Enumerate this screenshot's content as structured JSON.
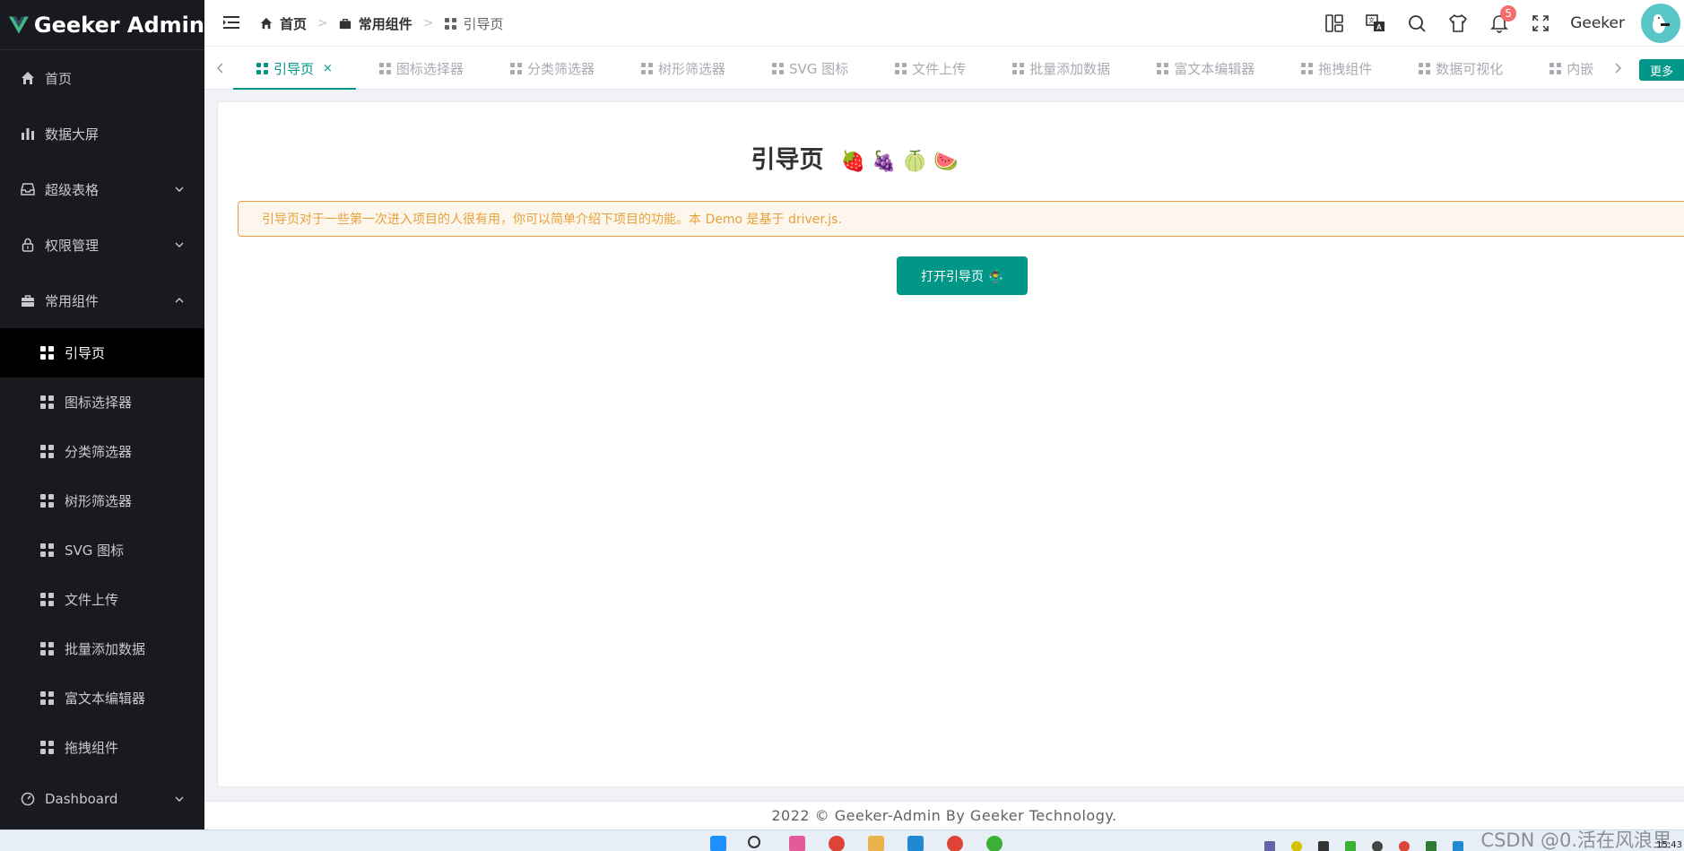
{
  "app": {
    "logo_text": "Geeker Admin"
  },
  "sidebar": {
    "items": [
      {
        "label": "首页",
        "icon": "home-icon"
      },
      {
        "label": "数据大屏",
        "icon": "bar-chart-icon"
      },
      {
        "label": "超级表格",
        "icon": "inbox-icon",
        "expandable": true
      },
      {
        "label": "权限管理",
        "icon": "lock-icon",
        "expandable": true
      },
      {
        "label": "常用组件",
        "icon": "briefcase-icon",
        "expanded": true
      }
    ],
    "sub_items": [
      {
        "label": "引导页",
        "active": true
      },
      {
        "label": "图标选择器"
      },
      {
        "label": "分类筛选器"
      },
      {
        "label": "树形筛选器"
      },
      {
        "label": "SVG 图标"
      },
      {
        "label": "文件上传"
      },
      {
        "label": "批量添加数据"
      },
      {
        "label": "富文本编辑器"
      },
      {
        "label": "拖拽组件"
      }
    ],
    "dashboard": {
      "label": "Dashboard",
      "icon": "odometer-icon"
    }
  },
  "header": {
    "breadcrumb": [
      {
        "label": "首页",
        "icon": "home-icon"
      },
      {
        "label": "常用组件",
        "icon": "briefcase-icon"
      },
      {
        "label": "引导页",
        "icon": "grid-icon"
      }
    ],
    "notification_count": "5",
    "username": "Geeker"
  },
  "tabs": {
    "items": [
      {
        "label": "引导页",
        "active": true,
        "closable": true
      },
      {
        "label": "图标选择器"
      },
      {
        "label": "分类筛选器"
      },
      {
        "label": "树形筛选器"
      },
      {
        "label": "SVG 图标"
      },
      {
        "label": "文件上传"
      },
      {
        "label": "批量添加数据"
      },
      {
        "label": "富文本编辑器"
      },
      {
        "label": "拖拽组件"
      },
      {
        "label": "数据可视化"
      },
      {
        "label": "内嵌"
      }
    ],
    "close_glyph": "×",
    "more_label": "更多"
  },
  "main": {
    "title": "引导页",
    "title_emoji": "🍓 🍇 🍈 🍉",
    "alert_text": "引导页对于一些第一次进入项目的人很有用，你可以简单介绍下项目的功能。本 Demo 是基于 driver.js.",
    "open_button_label": "打开引导页 🤹‍♂️"
  },
  "footer": {
    "text": "2022 © Geeker-Admin By Geeker Technology."
  },
  "taskbar": {
    "watermark": "CSDN @0.活在风浪里",
    "clock": "15:43"
  },
  "colors": {
    "primary": "#009688",
    "sidebar_bg": "#191a20",
    "alert_bg": "#fdf6ec",
    "alert_text": "#e6a23c",
    "badge": "#f56c6c"
  }
}
